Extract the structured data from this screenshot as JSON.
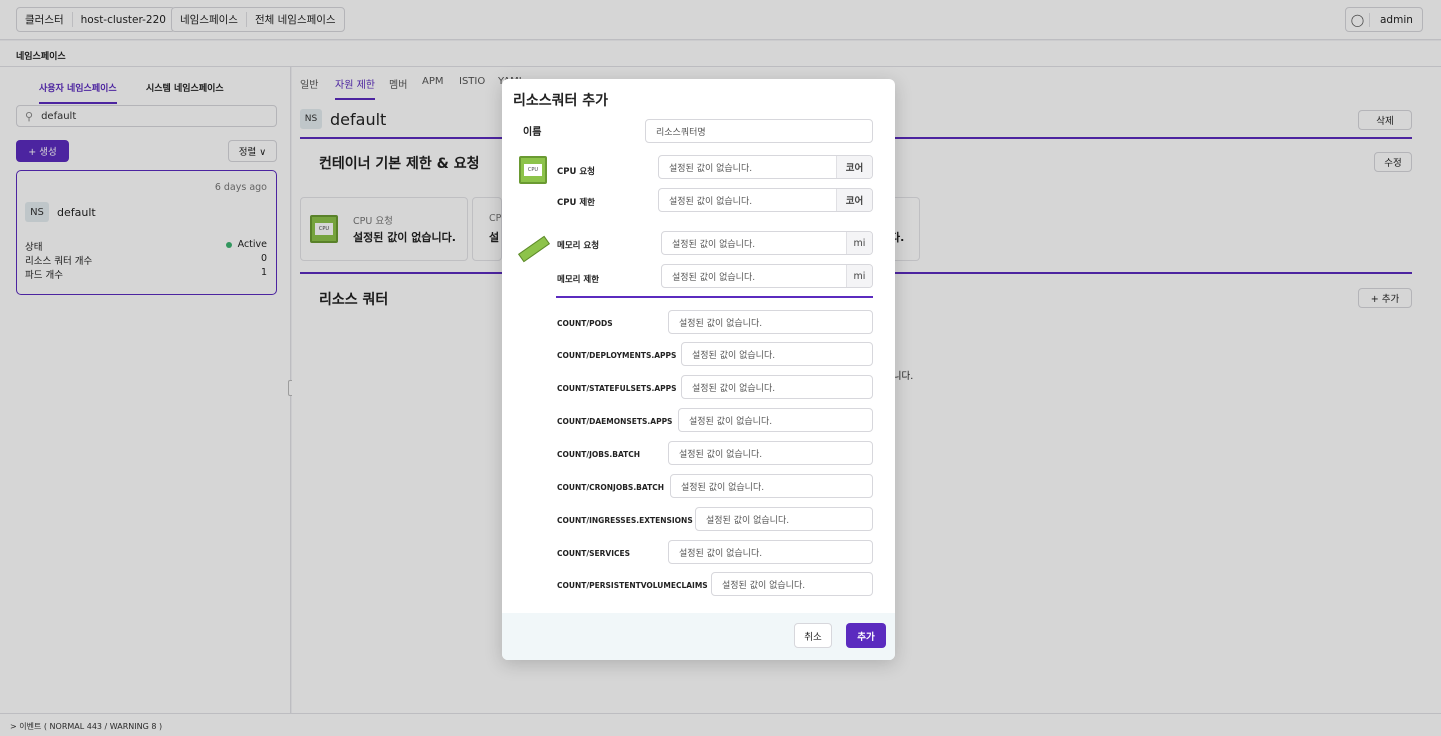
{
  "topbar": {
    "cluster_label": "클러스터",
    "cluster_value": "host-cluster-220",
    "namespace_label": "네임스페이스",
    "namespace_value": "전체 네임스페이스",
    "user": "admin",
    "user_icon": "user-circle-icon"
  },
  "subbar": {
    "title": "네임스페이스"
  },
  "left": {
    "tabs": [
      "사용자 네임스페이스",
      "시스템 네임스페이스"
    ],
    "search_value": "default",
    "create_label": "+ 생성",
    "sort_label": "정렬 ∨",
    "card": {
      "ago": "6 days ago",
      "badge": "NS",
      "name": "default",
      "rows": [
        {
          "k": "상태",
          "v": "Active"
        },
        {
          "k": "리소스 쿼터 개수",
          "v": "0"
        },
        {
          "k": "파드 개수",
          "v": "1"
        }
      ]
    }
  },
  "main": {
    "tabs": [
      "일반",
      "자원 제한",
      "멤버",
      "APM",
      "ISTIO",
      "YAML"
    ],
    "badge": "NS",
    "title": "default",
    "delete_label": "삭제",
    "section1": "컨테이너 기본 제한 & 요청",
    "edit_label": "수정",
    "card_label": "CPU 요청",
    "card_value": "설정된 값이 없습니다.",
    "card2_label": "CP",
    "card2_value": "설",
    "card_tail": "다.",
    "section2": "리소스 쿼터",
    "add_label": "+ 추가",
    "empty_tail": "습니다."
  },
  "bottombar": {
    "text": "> 이벤트 ( NORMAL 443 / WARNING 8 )"
  },
  "modal": {
    "title": "리소스쿼터 추가",
    "name_label": "이름",
    "name_placeholder": "리소스쿼터명",
    "placeholder": "설정된 값이 없습니다.",
    "cpu_req_label": "CPU 요청",
    "cpu_lim_label": "CPU 제한",
    "cpu_unit": "코어",
    "mem_req_label": "메모리 요청",
    "mem_lim_label": "메모리 제한",
    "mem_unit": "mi",
    "counts": [
      "COUNT/PODS",
      "COUNT/DEPLOYMENTS.APPS",
      "COUNT/STATEFULSETS.APPS",
      "COUNT/DAEMONSETS.APPS",
      "COUNT/JOBS.BATCH",
      "COUNT/CRONJOBS.BATCH",
      "COUNT/INGRESSES.EXTENSIONS",
      "COUNT/SERVICES",
      "COUNT/PERSISTENTVOLUMECLAIMS"
    ],
    "cancel_label": "취소",
    "submit_label": "추가",
    "accent": "#5b2bbf"
  }
}
